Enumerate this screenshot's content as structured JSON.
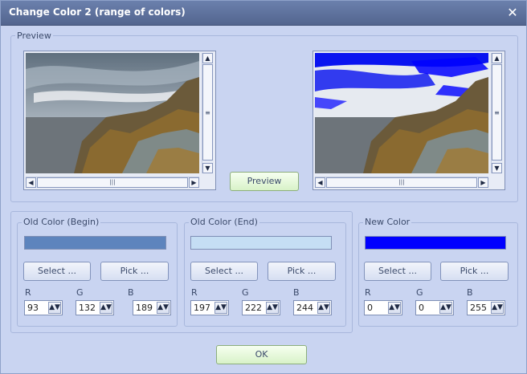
{
  "window": {
    "title": "Change Color 2 (range of colors)",
    "close_icon": "close-icon"
  },
  "preview_group": {
    "label": "Preview"
  },
  "preview_button": {
    "label": "Preview"
  },
  "old_begin": {
    "label": "Old Color (Begin)",
    "color": "#5d84bd",
    "select_label": "Select ...",
    "pick_label": "Pick ...",
    "r": "93",
    "g": "132",
    "b": "189"
  },
  "old_end": {
    "label": "Old Color (End)",
    "color": "#c5def4",
    "select_label": "Select ...",
    "pick_label": "Pick ...",
    "r": "197",
    "g": "222",
    "b": "244"
  },
  "new_color": {
    "label": "New Color",
    "color": "#0000ff",
    "select_label": "Select ...",
    "pick_label": "Pick ...",
    "r": "0",
    "g": "0",
    "b": "255"
  },
  "channels": {
    "r": "R",
    "g": "G",
    "b": "B"
  },
  "ok_button": {
    "label": "OK"
  },
  "scroll": {
    "grip": "≡",
    "hgrip": "|||"
  }
}
